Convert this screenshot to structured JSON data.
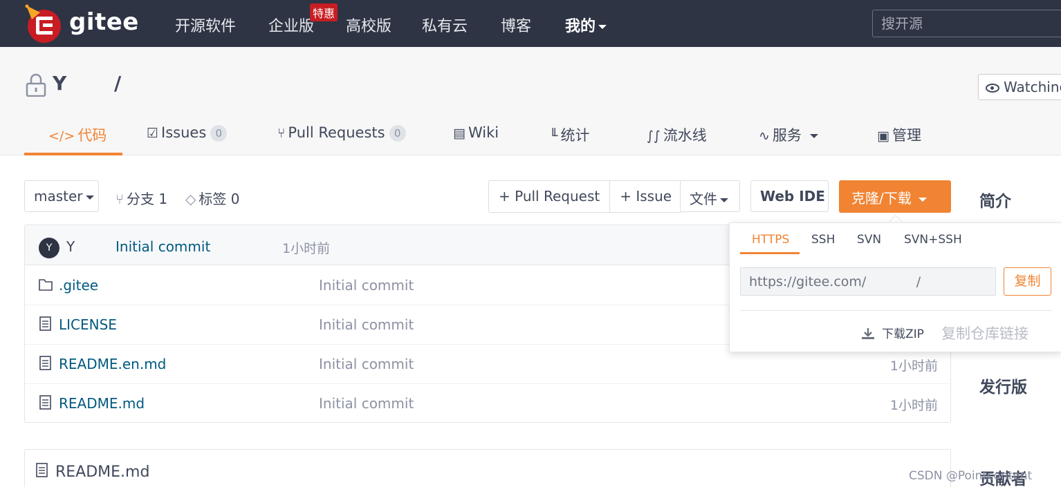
{
  "topnav": {
    "logo_text": "gitee",
    "items": [
      {
        "label": "开源软件"
      },
      {
        "label": "企业版"
      },
      {
        "label": "高校版"
      },
      {
        "label": "私有云"
      },
      {
        "label": "博客"
      },
      {
        "label": "我的"
      }
    ],
    "badge": "特惠",
    "search_placeholder": "搜开源"
  },
  "repo": {
    "owner": "Y",
    "slash": "/",
    "watch_label": "Watching"
  },
  "tabs": [
    {
      "label": "代码",
      "icon": "code-icon",
      "glyph": "</>"
    },
    {
      "label": "Issues",
      "icon": "issues-icon",
      "glyph": "☑",
      "count": "0"
    },
    {
      "label": "Pull Requests",
      "icon": "pull-request-icon",
      "glyph": "⑂",
      "count": "0"
    },
    {
      "label": "Wiki",
      "icon": "book-icon",
      "glyph": "▤"
    },
    {
      "label": "统计",
      "icon": "chart-icon",
      "glyph": "╙"
    },
    {
      "label": "流水线",
      "icon": "pipeline-icon",
      "glyph": "∫∫"
    },
    {
      "label": "服务",
      "icon": "pulse-icon",
      "glyph": "∿"
    },
    {
      "label": "管理",
      "icon": "settings-doc-icon",
      "glyph": "▣"
    }
  ],
  "toolbar": {
    "branch": "master",
    "branches_label": "分支 1",
    "tags_label": "标签 0",
    "pull_request_label": "+ Pull Request",
    "issue_label": "+ Issue",
    "file_label": "文件",
    "webide_label": "Web IDE",
    "clone_label": "克隆/下载"
  },
  "sidebar": {
    "intro": "简介",
    "releases": "发行版",
    "contributors": "贡献者"
  },
  "commit": {
    "avatar": "Y",
    "author": "Y",
    "message": "Initial commit",
    "time": "1小时前"
  },
  "files": [
    {
      "name": ".gitee",
      "type": "folder",
      "message": "Initial commit",
      "time": ""
    },
    {
      "name": "LICENSE",
      "type": "file",
      "message": "Initial commit",
      "time": ""
    },
    {
      "name": "README.en.md",
      "type": "file",
      "message": "Initial commit",
      "time": "1小时前"
    },
    {
      "name": "README.md",
      "type": "file",
      "message": "Initial commit",
      "time": "1小时前"
    }
  ],
  "clone": {
    "protocols": [
      "HTTPS",
      "SSH",
      "SVN",
      "SVN+SSH"
    ],
    "active_protocol": "HTTPS",
    "url": "https://gitee.com/            /",
    "copy_label": "复制",
    "download_zip": "下载ZIP",
    "copy_link": "复制仓库链接"
  },
  "readme": {
    "title": "README.md"
  },
  "watermark": "CSDN @Pointcontent",
  "colors": {
    "accent": "#f18433",
    "nav_bg": "#2e3444",
    "link": "#005980",
    "brand_red": "#c71d23"
  }
}
